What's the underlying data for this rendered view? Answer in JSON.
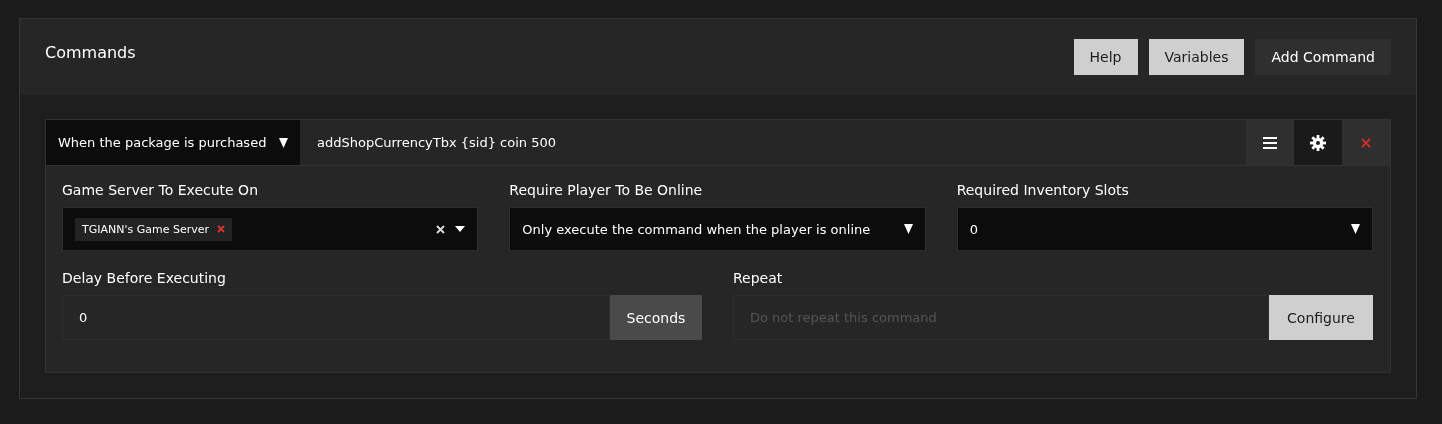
{
  "header": {
    "title": "Commands",
    "buttons": [
      {
        "label": "Help",
        "kind": "light"
      },
      {
        "label": "Variables",
        "kind": "light"
      },
      {
        "label": "Add Command",
        "kind": "dark"
      }
    ]
  },
  "commands": [
    {
      "trigger": "When the package is purchased",
      "command": "addShopCurrencyTbx {sid} coin 500",
      "settings_open": true,
      "rows": [
        [
          {
            "kind": "tags",
            "label": "Game Server To Execute On",
            "tags": [
              "TGIANN's Game Server"
            ]
          },
          {
            "kind": "select",
            "label": "Require Player To Be Online",
            "value": "Only execute the command when the player is online"
          },
          {
            "kind": "select",
            "label": "Required Inventory Slots",
            "value": "0"
          }
        ],
        [
          {
            "kind": "addon",
            "label": "Delay Before Executing",
            "value": "0",
            "addon": {
              "label": "Seconds",
              "kind": "dark"
            }
          },
          {
            "kind": "addon",
            "label": "Repeat",
            "placeholder": "Do not repeat this command",
            "addon": {
              "label": "Configure",
              "kind": "light"
            }
          }
        ]
      ]
    }
  ]
}
